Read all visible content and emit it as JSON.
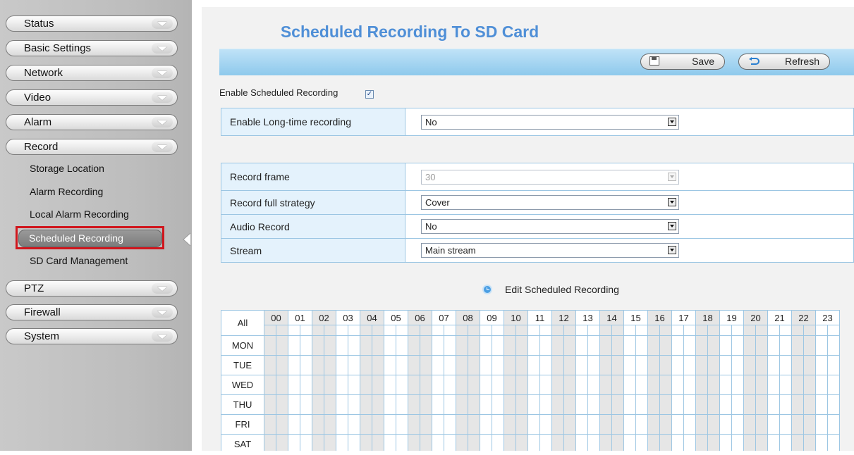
{
  "sidebar": {
    "menus": [
      "Status",
      "Basic Settings",
      "Network",
      "Video",
      "Alarm",
      "Record"
    ],
    "record_submenu": [
      "Storage Location",
      "Alarm Recording",
      "Local Alarm Recording"
    ],
    "active_item": "Scheduled Recording",
    "after_active": "SD Card Management",
    "menus_bottom": [
      "PTZ",
      "Firewall",
      "System"
    ]
  },
  "page": {
    "title": "Scheduled Recording To SD Card",
    "save_label": "Save",
    "refresh_label": "Refresh",
    "enable_label": "Enable Scheduled Recording",
    "enable_checked": "✓",
    "edit_label": "Edit Scheduled Recording"
  },
  "form": {
    "long_time": {
      "label": "Enable Long-time recording",
      "value": "No"
    },
    "record_frame": {
      "label": "Record frame",
      "value": "30"
    },
    "full_strategy": {
      "label": "Record full strategy",
      "value": "Cover"
    },
    "audio": {
      "label": "Audio Record",
      "value": "No"
    },
    "stream": {
      "label": "Stream",
      "value": "Main stream"
    }
  },
  "schedule": {
    "all_label": "All",
    "hours": [
      "00",
      "01",
      "02",
      "03",
      "04",
      "05",
      "06",
      "07",
      "08",
      "09",
      "10",
      "11",
      "12",
      "13",
      "14",
      "15",
      "16",
      "17",
      "18",
      "19",
      "20",
      "21",
      "22",
      "23"
    ],
    "days": [
      "MON",
      "TUE",
      "WED",
      "THU",
      "FRI",
      "SAT"
    ]
  },
  "colors": {
    "title": "#4f8fd7",
    "toolbar": "#a6d5f1",
    "active_outline": "#d0161d"
  }
}
